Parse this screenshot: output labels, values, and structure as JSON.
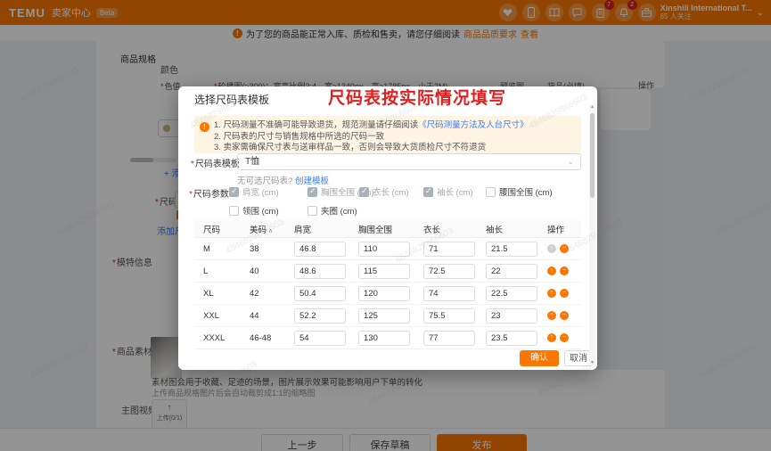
{
  "header": {
    "logo": "TEMU",
    "app_title": "卖家中心",
    "beta": "Beta",
    "doc_badge": "7",
    "bell_badge": "2",
    "store_name": "Xinshili International T...",
    "store_followers": "85 人关注"
  },
  "notice_bar": {
    "text": "为了您的商品能正常入库、质检和售卖，请您仔细阅读",
    "link": "商品品质要求",
    "action": "查看"
  },
  "background_page": {
    "section_label": "商品规格",
    "color_group_label": "颜色",
    "color_value_label": "色值",
    "carousel_header": "轮播图(≥300)；宽高比例3:4，宽≥1340px，高≥1785px，小于2M)",
    "preview_header": "预览图",
    "goods_header": "货品(必填)",
    "operation_header": "操作",
    "add_link": "+ 添加",
    "size_label": "尺码",
    "add_size_link": "添加尺码",
    "model_info_label": "模特信息",
    "material_label": "商品素材图",
    "material_tip": "素材图会用于收藏、足迹的场景，图片展示效果可能影响用户下单的转化",
    "material_subtip": "上传商品规格图片后会自动裁剪成1:1的缩略图",
    "main_video_label": "主图视频",
    "upload_label": "上传(0/1)",
    "prev_button": "上一步",
    "draft_button": "保存草稿",
    "publish_button": "发布"
  },
  "modal": {
    "title": "选择尺码表模板",
    "annotation": "尺码表按实际情况填写",
    "notice_lines": [
      "1. 尺码测量不准确可能导致退货，规范测量请仔细阅读",
      "2. 尺码表的尺寸与销售规格中所选的尺码一致",
      "3. 卖家需确保尺寸表与送审样品一致，否则会导致大货质检尺寸不符退货"
    ],
    "notice_link": "《尺码测量方法及人台尺寸》",
    "template_label": "尺码表模板",
    "template_value": "T恤",
    "no_template_text": "无可选尺码表?",
    "create_template_link": "创建模板",
    "params_label": "尺码参数",
    "params": [
      {
        "label": "肩宽 (cm)",
        "checked": true,
        "disabled": true
      },
      {
        "label": "胸围全围 (cm)",
        "checked": true,
        "disabled": true
      },
      {
        "label": "衣长 (cm)",
        "checked": true,
        "disabled": true
      },
      {
        "label": "袖长 (cm)",
        "checked": true,
        "disabled": true
      },
      {
        "label": "腰围全围 (cm)",
        "checked": false,
        "disabled": false
      },
      {
        "label": "领围 (cm)",
        "checked": false,
        "disabled": false
      },
      {
        "label": "夹圈 (cm)",
        "checked": false,
        "disabled": false
      }
    ],
    "table": {
      "headers": [
        "尺码",
        "美码",
        "肩宽",
        "胸围全围",
        "衣长",
        "袖长",
        "操作"
      ],
      "rows": [
        {
          "size": "M",
          "us": "38",
          "shoulder": "46.8",
          "chest": "110",
          "length": "71",
          "sleeve": "21.5"
        },
        {
          "size": "L",
          "us": "40",
          "shoulder": "48.6",
          "chest": "115",
          "length": "72.5",
          "sleeve": "22"
        },
        {
          "size": "XL",
          "us": "42",
          "shoulder": "50.4",
          "chest": "120",
          "length": "74",
          "sleeve": "22.5"
        },
        {
          "size": "XXL",
          "us": "44",
          "shoulder": "52.2",
          "chest": "125",
          "length": "75.5",
          "sleeve": "23"
        },
        {
          "size": "XXXL",
          "us": "46-48",
          "shoulder": "54",
          "chest": "130",
          "length": "77",
          "sleeve": "23.5"
        }
      ]
    },
    "confirm": "确认",
    "cancel": "取消"
  },
  "icons": {
    "info": "!",
    "sort_asc": "∧",
    "move_up": "↑",
    "delete": "−",
    "chevron_down": "⌄",
    "upload": "↑",
    "scroll_up": "▴",
    "scroll_down": "▾"
  },
  "watermark": "4846829866603",
  "colors": {
    "accent_orange": "#fb7701",
    "annotation_red": "#e01f1f",
    "link_blue": "#3f7ef7",
    "notice_bg": "#fdf4e3"
  }
}
